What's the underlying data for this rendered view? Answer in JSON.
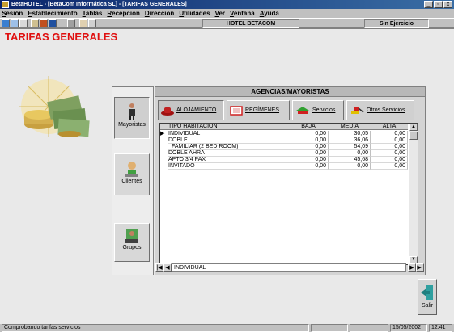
{
  "window": {
    "title": "BetaHOTEL - [BetaCom Informática SL] - [TARIFAS GENERALES]",
    "buttons": [
      "_",
      "▫",
      "x"
    ]
  },
  "menu": [
    "Sesión",
    "Establecimiento",
    "Tablas",
    "Recepción",
    "Dirección",
    "Utilidades",
    "Ver",
    "Ventana",
    "Ayuda"
  ],
  "toolbar": {
    "hotel": "HOTEL BETACOM",
    "ejercicio": "Sin Ejercicio"
  },
  "page": {
    "title": "TARIFAS GENERALES"
  },
  "leftnav": [
    {
      "label": "Mayoristas",
      "icon": "person-icon"
    },
    {
      "label": "Clientes",
      "icon": "reception-clerk-icon"
    },
    {
      "label": "Grupos",
      "icon": "group-icon"
    }
  ],
  "panel": {
    "header": "AGENCIAS/MAYORISTAS",
    "tabs": [
      {
        "label": "ALOJAMIENTO",
        "icon": "hat-icon"
      },
      {
        "label": "REGÍMENES",
        "icon": "tv-icon"
      },
      {
        "label": "Servicios",
        "icon": "tools-icon"
      },
      {
        "label": "Otros Servicios",
        "icon": "excavator-icon"
      }
    ]
  },
  "grid": {
    "columns": [
      "TIPO HABITACION",
      "BAJA",
      "MEDIA",
      "ALTA"
    ],
    "rows": [
      {
        "tipo": "INDIVIDUAL",
        "baja": "0,00",
        "media": "30,05",
        "alta": "0,00"
      },
      {
        "tipo": "DOBLE",
        "baja": "0,00",
        "media": "36,06",
        "alta": "0,00"
      },
      {
        "tipo": "FAMILIAR (2 BED ROOM)",
        "baja": "0,00",
        "media": "54,09",
        "alta": "0,00"
      },
      {
        "tipo": "DOBLE AHRA",
        "baja": "0,00",
        "media": "0,00",
        "alta": "0,00"
      },
      {
        "tipo": "APTO 3/4 PAX",
        "baja": "0,00",
        "media": "45,68",
        "alta": "0,00"
      },
      {
        "tipo": "INVITADO",
        "baja": "0,00",
        "media": "0,00",
        "alta": "0,00"
      }
    ],
    "current": "INDIVIDUAL"
  },
  "exit": {
    "label": "Salir"
  },
  "status": {
    "message": "Comprobando tarifas servicios",
    "date": "15/05/2002",
    "time": "12:41"
  },
  "colors": {
    "title_red": "#e01010",
    "titlebar": "#0a246a"
  }
}
